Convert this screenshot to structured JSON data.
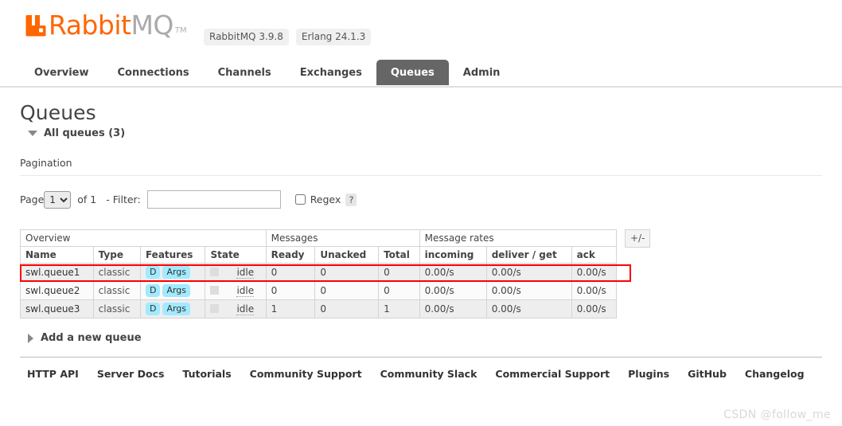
{
  "header": {
    "logo_rabbit": "Rabbit",
    "logo_mq": "MQ",
    "logo_tm": "TM",
    "badges": [
      {
        "label": "RabbitMQ 3.9.8"
      },
      {
        "label": "Erlang 24.1.3"
      }
    ]
  },
  "nav": {
    "items": [
      {
        "label": "Overview",
        "active": false
      },
      {
        "label": "Connections",
        "active": false
      },
      {
        "label": "Channels",
        "active": false
      },
      {
        "label": "Exchanges",
        "active": false
      },
      {
        "label": "Queues",
        "active": true
      },
      {
        "label": "Admin",
        "active": false
      }
    ]
  },
  "page": {
    "title": "Queues",
    "section_label": "All queues (3)",
    "pagination_label": "Pagination"
  },
  "pager": {
    "page_label": "Page",
    "page_value": "1",
    "page_options": [
      "1"
    ],
    "of_label": "of 1",
    "filter_label": "- Filter:",
    "filter_value": "",
    "filter_placeholder": "",
    "regex_label": "Regex",
    "regex_checked": false,
    "help_label": "?"
  },
  "table": {
    "group_headers": [
      {
        "label": "Overview",
        "span": 4
      },
      {
        "label": "Messages",
        "span": 3
      },
      {
        "label": "Message rates",
        "span": 3
      }
    ],
    "columns": [
      "Name",
      "Type",
      "Features",
      "State",
      "Ready",
      "Unacked",
      "Total",
      "incoming",
      "deliver / get",
      "ack"
    ],
    "plus_minus_label": "+/-",
    "rows": [
      {
        "name": "swl.queue1",
        "type": "classic",
        "features": [
          "D",
          "Args"
        ],
        "state": "idle",
        "ready": "0",
        "unacked": "0",
        "total": "0",
        "incoming": "0.00/s",
        "deliver_get": "0.00/s",
        "ack": "0.00/s",
        "highlighted": true
      },
      {
        "name": "swl.queue2",
        "type": "classic",
        "features": [
          "D",
          "Args"
        ],
        "state": "idle",
        "ready": "0",
        "unacked": "0",
        "total": "0",
        "incoming": "0.00/s",
        "deliver_get": "0.00/s",
        "ack": "0.00/s",
        "highlighted": false
      },
      {
        "name": "swl.queue3",
        "type": "classic",
        "features": [
          "D",
          "Args"
        ],
        "state": "idle",
        "ready": "1",
        "unacked": "0",
        "total": "1",
        "incoming": "0.00/s",
        "deliver_get": "0.00/s",
        "ack": "0.00/s",
        "highlighted": false
      }
    ]
  },
  "add_queue": {
    "label": "Add a new queue"
  },
  "footer": {
    "links": [
      "HTTP API",
      "Server Docs",
      "Tutorials",
      "Community Support",
      "Community Slack",
      "Commercial Support",
      "Plugins",
      "GitHub",
      "Changelog"
    ]
  },
  "watermark": {
    "text": "CSDN @follow_me"
  },
  "colors": {
    "brand_orange": "#f60",
    "active_tab": "#666666",
    "badge_cyan": "#a1eaff",
    "highlight_red": "#ff0000"
  }
}
